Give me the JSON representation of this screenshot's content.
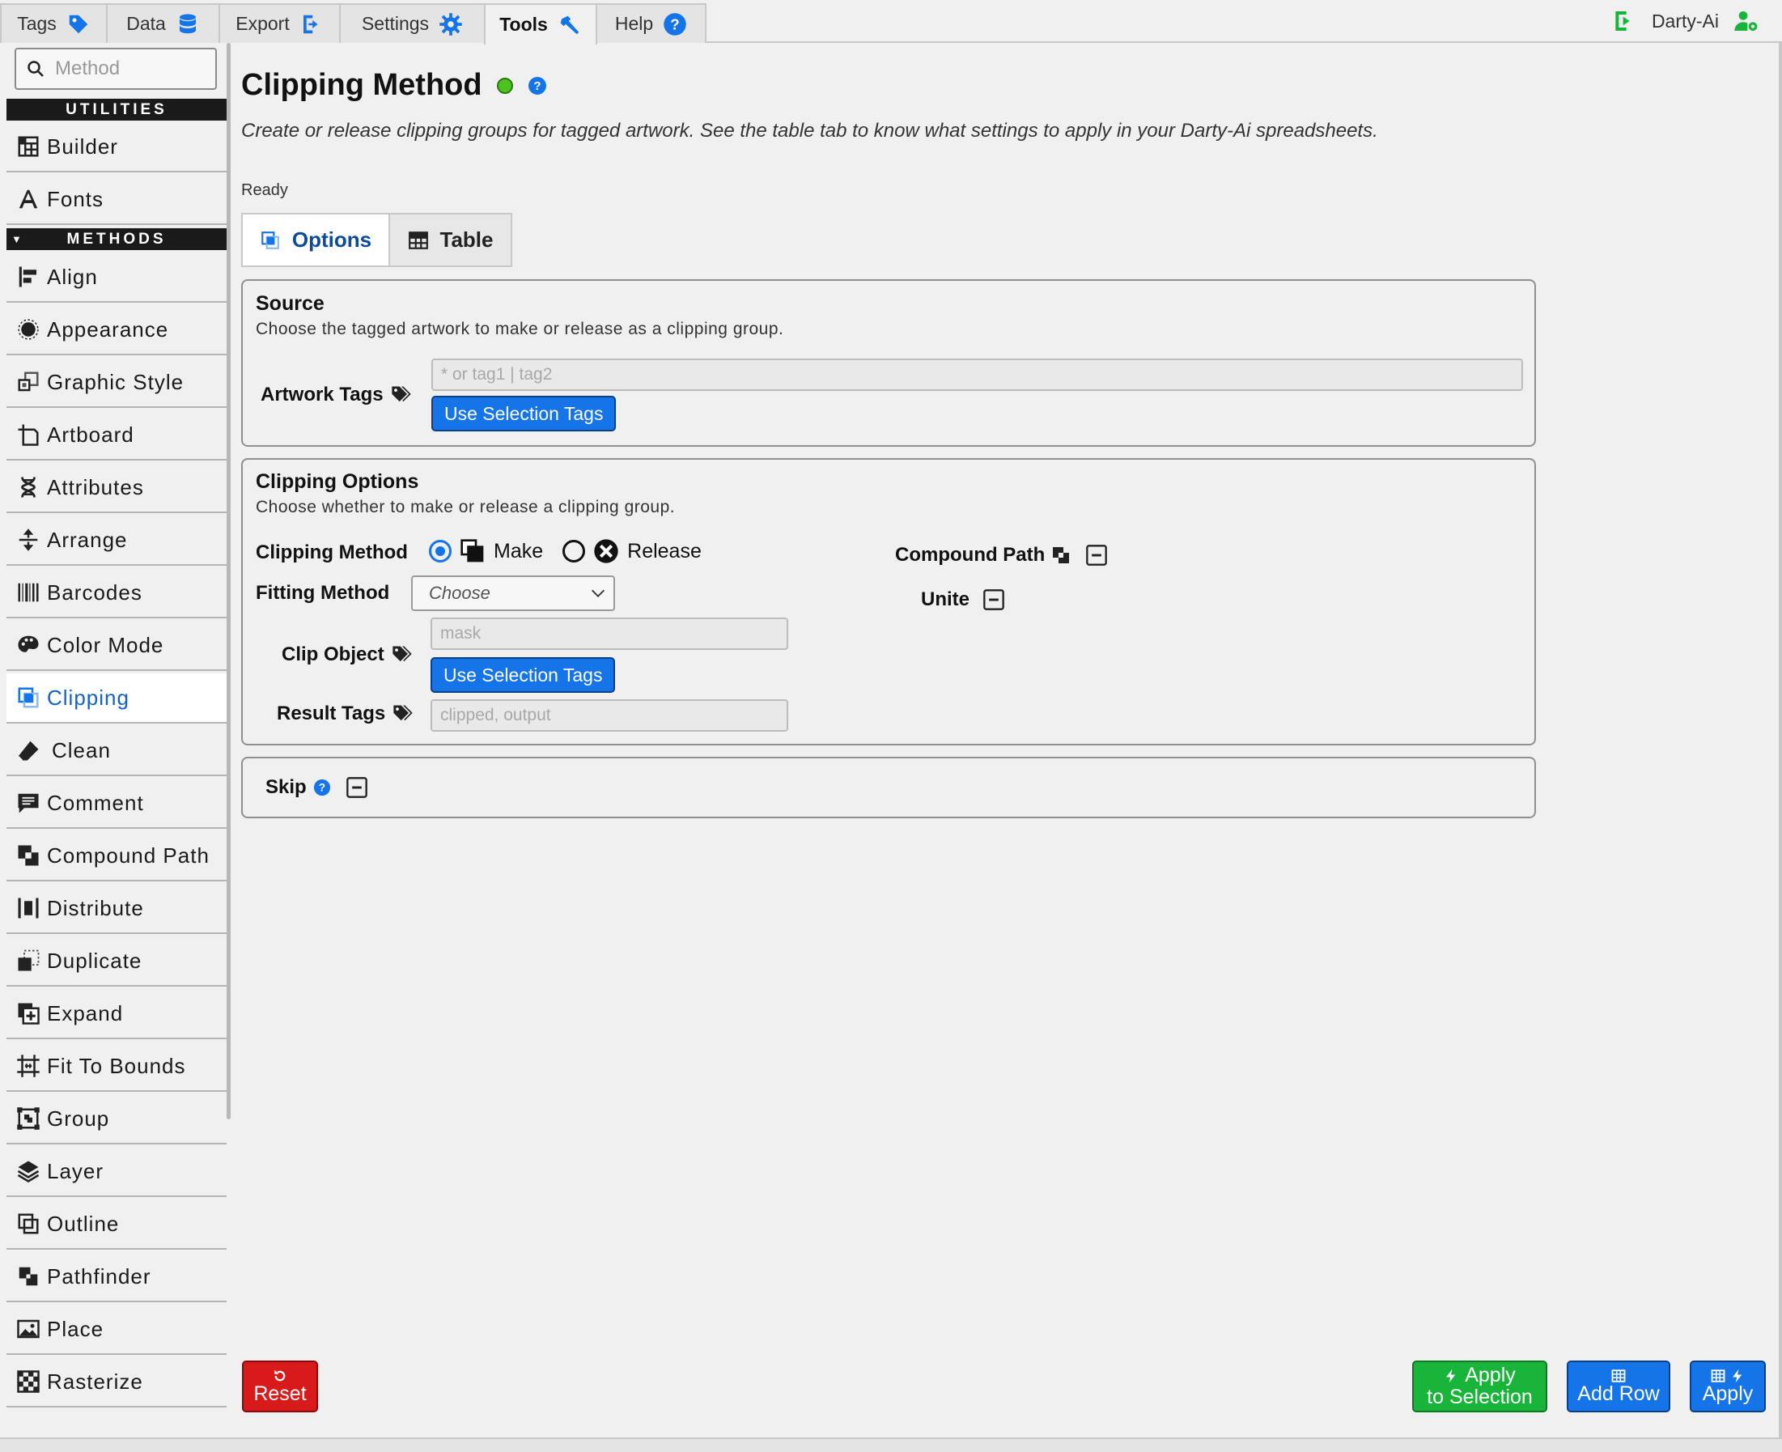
{
  "top_tabs": [
    {
      "label": "Tags",
      "icon": "tag-icon"
    },
    {
      "label": "Data",
      "icon": "database-icon"
    },
    {
      "label": "Export",
      "icon": "export-icon"
    },
    {
      "label": "Settings",
      "icon": "gear-icon"
    },
    {
      "label": "Tools",
      "icon": "hammer-icon",
      "active": true
    },
    {
      "label": "Help",
      "icon": "help-icon"
    }
  ],
  "user": {
    "name": "Darty-Ai"
  },
  "sidebar": {
    "search_placeholder": "Method",
    "utilities_header": "UTILITIES",
    "methods_header": "METHODS",
    "utilities": [
      {
        "label": "Builder",
        "icon": "builder-icon"
      },
      {
        "label": "Fonts",
        "icon": "font-icon"
      }
    ],
    "methods": [
      {
        "label": "Align",
        "icon": "align-icon"
      },
      {
        "label": "Appearance",
        "icon": "appearance-icon"
      },
      {
        "label": "Graphic Style",
        "icon": "graphic-style-icon"
      },
      {
        "label": "Artboard",
        "icon": "artboard-icon"
      },
      {
        "label": "Attributes",
        "icon": "dna-icon"
      },
      {
        "label": "Arrange",
        "icon": "arrange-icon"
      },
      {
        "label": "Barcodes",
        "icon": "barcode-icon"
      },
      {
        "label": "Color Mode",
        "icon": "palette-icon"
      },
      {
        "label": "Clipping",
        "icon": "clipping-icon",
        "active": true
      },
      {
        "label": "Clean",
        "icon": "eraser-icon"
      },
      {
        "label": "Comment",
        "icon": "comment-icon"
      },
      {
        "label": "Compound Path",
        "icon": "compound-path-icon"
      },
      {
        "label": "Distribute",
        "icon": "distribute-icon"
      },
      {
        "label": "Duplicate",
        "icon": "duplicate-icon"
      },
      {
        "label": "Expand",
        "icon": "expand-icon"
      },
      {
        "label": "Fit To Bounds",
        "icon": "fit-bounds-icon"
      },
      {
        "label": "Group",
        "icon": "group-icon"
      },
      {
        "label": "Layer",
        "icon": "layer-icon"
      },
      {
        "label": "Outline",
        "icon": "outline-icon"
      },
      {
        "label": "Pathfinder",
        "icon": "pathfinder-icon"
      },
      {
        "label": "Place",
        "icon": "image-icon"
      },
      {
        "label": "Rasterize",
        "icon": "checkerboard-icon"
      }
    ]
  },
  "main": {
    "title": "Clipping Method",
    "status_color": "#4cc21f",
    "description": "Create or release clipping groups for tagged artwork. See the table tab to know what settings to apply in your Darty-Ai spreadsheets.",
    "status_text": "Ready",
    "tabs": [
      {
        "label": "Options",
        "active": true
      },
      {
        "label": "Table"
      }
    ],
    "source": {
      "title": "Source",
      "subtitle": "Choose the tagged artwork to make or release as a clipping group.",
      "artwork_tags_label": "Artwork Tags",
      "artwork_tags_placeholder": "* or tag1 | tag2",
      "use_selection_label": "Use Selection Tags"
    },
    "clipping_options": {
      "title": "Clipping Options",
      "subtitle": "Choose whether to make or release a clipping group.",
      "clipping_method_label": "Clipping Method",
      "make_label": "Make",
      "release_label": "Release",
      "selected_method": "Make",
      "fitting_method_label": "Fitting Method",
      "fitting_method_value": "Choose",
      "clip_object_label": "Clip Object",
      "clip_object_placeholder": "mask",
      "use_selection_label": "Use Selection Tags",
      "result_tags_label": "Result Tags",
      "result_tags_placeholder": "clipped, output",
      "compound_path_label": "Compound Path",
      "unite_label": "Unite"
    },
    "skip": {
      "label": "Skip"
    }
  },
  "footer": {
    "reset_label": "Reset",
    "apply_selection_line1": "Apply",
    "apply_selection_line2": "to Selection",
    "add_row_label": "Add Row",
    "apply_label": "Apply"
  },
  "colors": {
    "accent_blue": "#1474e8",
    "reset_red": "#d91a1a",
    "apply_green": "#18b53a",
    "user_green": "#18b53a"
  }
}
